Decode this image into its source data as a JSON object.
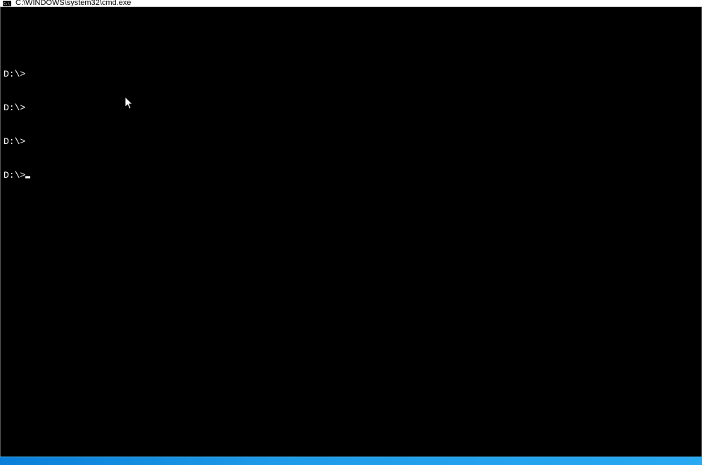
{
  "window": {
    "title": "C:\\WINDOWS\\system32\\cmd.exe"
  },
  "terminal": {
    "prompts": [
      "D:\\>",
      "D:\\>",
      "D:\\>",
      "D:\\>"
    ]
  }
}
